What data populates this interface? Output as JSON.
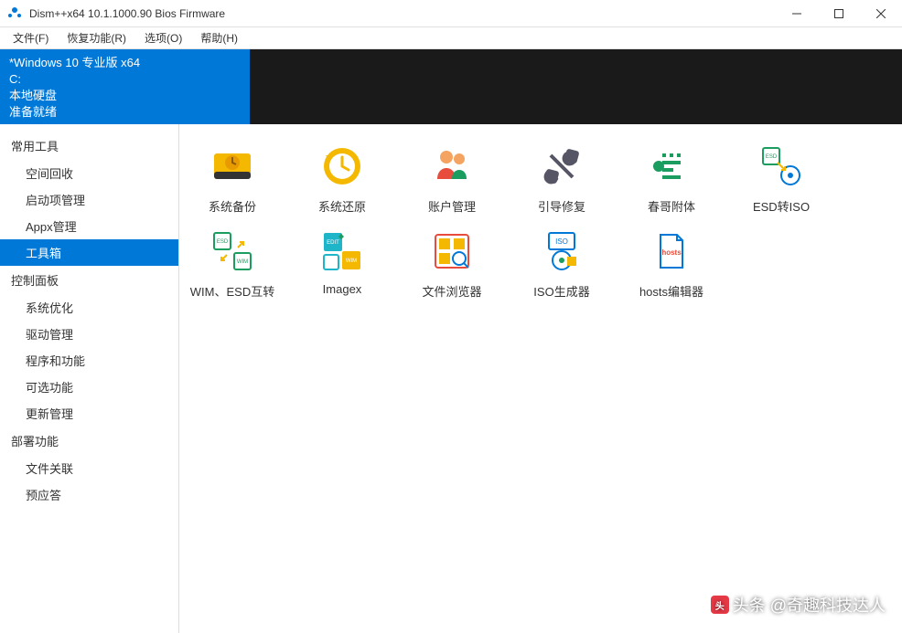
{
  "titlebar": {
    "title": "Dism++x64 10.1.1000.90 Bios Firmware"
  },
  "menubar": {
    "file": "文件(F)",
    "recovery": "恢复功能(R)",
    "options": "选项(O)",
    "help": "帮助(H)"
  },
  "infobar": {
    "os": "*Windows 10 专业版 x64",
    "drive": "C:",
    "disk_type": "本地硬盘",
    "status": "准备就绪"
  },
  "sidebar": {
    "group1": "常用工具",
    "item_space": "空间回收",
    "item_startup": "启动项管理",
    "item_appx": "Appx管理",
    "item_toolbox": "工具箱",
    "group2": "控制面板",
    "item_sysopt": "系统优化",
    "item_driver": "驱动管理",
    "item_programs": "程序和功能",
    "item_optional": "可选功能",
    "item_update": "更新管理",
    "group3": "部署功能",
    "item_fileassoc": "文件关联",
    "item_answerfile": "预应答"
  },
  "tools": {
    "backup": "系统备份",
    "restore": "系统还原",
    "account": "账户管理",
    "boot": "引导修复",
    "chunge": "春哥附体",
    "esd_iso": "ESD转ISO",
    "wim_esd": "WIM、ESD互转",
    "imagex": "Imagex",
    "explorer": "文件浏览器",
    "iso_gen": "ISO生成器",
    "hosts": "hosts编辑器"
  },
  "watermark": "头条 @奇趣科技达人"
}
